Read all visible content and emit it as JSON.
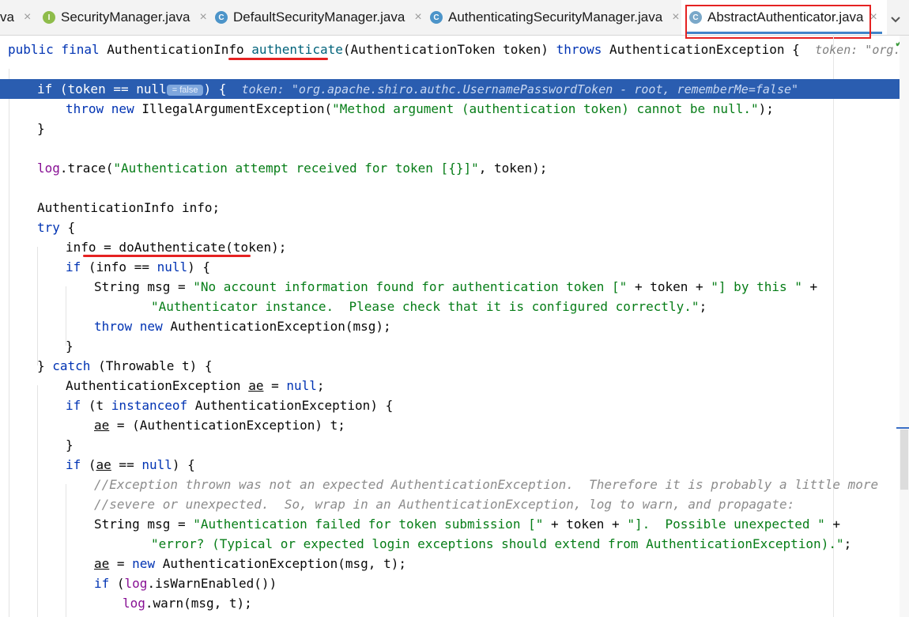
{
  "tabs": [
    {
      "label": "va",
      "icon": "none",
      "close": "×"
    },
    {
      "label": "SecurityManager.java",
      "icon": "interface-icon",
      "icon_letter": "I",
      "icon_color": "#8ebc4a",
      "close": "×"
    },
    {
      "label": "DefaultSecurityManager.java",
      "icon": "class-icon",
      "icon_letter": "C",
      "icon_color": "#4c94c9",
      "close": "×"
    },
    {
      "label": "AuthenticatingSecurityManager.java",
      "icon": "class-icon",
      "icon_letter": "C",
      "icon_color": "#4c94c9",
      "close": "×"
    },
    {
      "label": "AbstractAuthenticator.java",
      "icon": "abstract-class-icon",
      "icon_letter": "C",
      "icon_color": "#7aa8c9",
      "close": "×",
      "active": true
    }
  ],
  "colors": {
    "highlight": "#2a5db0",
    "keyword": "#0033b3",
    "string": "#067d17",
    "field": "#871094",
    "comment": "#8c8c8c",
    "annotation": "#e52222"
  },
  "code": {
    "signature": {
      "t1": "public final",
      "t2": " AuthenticationInfo ",
      "t3": "authenticate",
      "t4": "(AuthenticationToken token) ",
      "t5": "throws",
      "t6": " AuthenticationException {",
      "hint": "token: \"org.apache.shi"
    },
    "l_if": {
      "t1": "if",
      "t2": " (token == ",
      "t3": "null",
      "inlay": "= false",
      "t4": ") {",
      "hint": "token: \"org.apache.shiro.authc.UsernamePasswordToken - root, rememberMe=false\""
    },
    "l_throw": {
      "t1": "throw new",
      "t2": " IllegalArgumentException(",
      "t3": "\"Method argument (authentication token) cannot be null.\"",
      "t4": ");"
    },
    "l_close1": "}",
    "l_log": {
      "t1": "log",
      "t2": ".trace(",
      "t3": "\"Authentication attempt received for token [{}]\"",
      "t4": ", token);"
    },
    "l_decl": "AuthenticationInfo info;",
    "l_try": {
      "t1": "try",
      "t2": " {"
    },
    "l_assign": "info = doAuthenticate(token);",
    "l_ifnull": {
      "t1": "if",
      "t2": " (info == ",
      "t3": "null",
      "t4": ") {"
    },
    "l_msg1": {
      "t1": "String msg = ",
      "t2": "\"No account information found for authentication token [\"",
      "t3": " + token + ",
      "t4": "\"] by this \"",
      "t5": " +"
    },
    "l_msg2": {
      "t1": "\"Authenticator instance.  Please check that it is configured correctly.\"",
      "t2": ";"
    },
    "l_throw2": {
      "t1": "throw new",
      "t2": " AuthenticationException(msg);"
    },
    "l_close2": "}",
    "l_catch": {
      "t1": "} ",
      "t2": "catch",
      "t3": " (Throwable t) {"
    },
    "l_ae": {
      "t1": "AuthenticationException ",
      "t2": "ae",
      "t3": " = ",
      "t4": "null",
      "t5": ";"
    },
    "l_inst": {
      "t1": "if",
      "t2": " (t ",
      "t3": "instanceof",
      "t4": " AuthenticationException) {"
    },
    "l_cast": {
      "t1": "ae",
      "t2": " = (AuthenticationException) t;"
    },
    "l_close3": "}",
    "l_aenull": {
      "t1": "if",
      "t2": " (",
      "t3": "ae",
      "t4": " == ",
      "t5": "null",
      "t6": ") {"
    },
    "l_c1": "//Exception thrown was not an expected AuthenticationException.  Therefore it is probably a little more",
    "l_c2": "//severe or unexpected.  So, wrap in an AuthenticationException, log to warn, and propagate:",
    "l_msg3": {
      "t1": "String msg = ",
      "t2": "\"Authentication failed for token submission [\"",
      "t3": " + token + ",
      "t4": "\"].  Possible unexpected \"",
      "t5": " +"
    },
    "l_msg4": {
      "t1": "\"error? (Typical or expected login exceptions should extend from AuthenticationException).\"",
      "t2": ";"
    },
    "l_new": {
      "t1": "ae",
      "t2": " = ",
      "t3": "new",
      "t4": " AuthenticationException(msg, t);"
    },
    "l_warnif": {
      "t1": "if",
      "t2": " (",
      "t3": "log",
      "t4": ".isWarnEnabled())"
    },
    "l_warn": {
      "t1": "log",
      "t2": ".warn(msg, t);"
    }
  }
}
